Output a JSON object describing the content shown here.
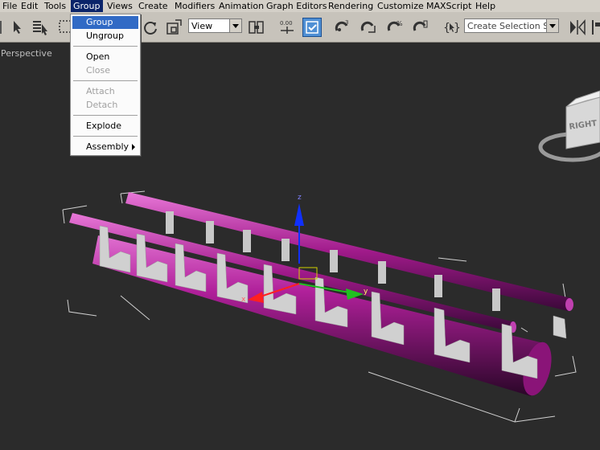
{
  "menubar": {
    "items": [
      {
        "label": "File"
      },
      {
        "label": "Edit"
      },
      {
        "label": "Tools"
      },
      {
        "label": "Group"
      },
      {
        "label": "Views"
      },
      {
        "label": "Create"
      },
      {
        "label": "Modifiers"
      },
      {
        "label": "Animation"
      },
      {
        "label": "Graph Editors"
      },
      {
        "label": "Rendering"
      },
      {
        "label": "Customize"
      },
      {
        "label": "MAXScript"
      },
      {
        "label": "Help"
      }
    ],
    "active": "Group"
  },
  "group_menu": {
    "items": [
      {
        "label": "Group",
        "state": "highlighted"
      },
      {
        "label": "Ungroup",
        "state": "enabled"
      },
      {
        "label": "Open",
        "state": "enabled"
      },
      {
        "label": "Close",
        "state": "disabled"
      },
      {
        "label": "Attach",
        "state": "disabled"
      },
      {
        "label": "Detach",
        "state": "disabled"
      },
      {
        "label": "Explode",
        "state": "enabled"
      },
      {
        "label": "Assembly",
        "state": "enabled",
        "submenu": true
      }
    ]
  },
  "toolbar": {
    "reference_coord": "View",
    "selection_set": "Create Selection Se"
  },
  "viewport": {
    "label": "Perspective",
    "viewcube_face": "RIGHT",
    "axis_labels": {
      "x": "x",
      "y": "y",
      "z": "z"
    }
  },
  "colors": {
    "menu_highlight": "#316ac5",
    "menubar_active": "#0a246a",
    "viewport_bg": "#2b2b2b",
    "rail_magenta": "#b0209a",
    "support_gray": "#c8c8c8"
  }
}
